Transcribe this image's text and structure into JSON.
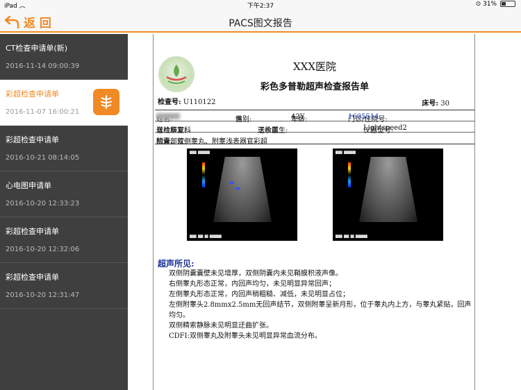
{
  "status_bar": {
    "device": "iPad",
    "time": "下午2:37",
    "battery": "31%",
    "battery_level": 0.31
  },
  "nav": {
    "back_label": "返 回",
    "title": "PACS图文报告"
  },
  "sidebar": {
    "items": [
      {
        "title": "CT检查申请单(新)",
        "date": "2016-11-14 09:00:39"
      },
      {
        "title": "彩超检查申请单",
        "date": "2016-11-07 16:00:21",
        "active": true
      },
      {
        "title": "彩超检查申请单",
        "date": "2016-10-21 08:14:05"
      },
      {
        "title": "心电图申请单",
        "date": "2016-10-20 12:33:23"
      },
      {
        "title": "彩超检查申请单",
        "date": "2016-10-20 12:32:06"
      },
      {
        "title": "彩超检查申请单",
        "date": "2016-10-20 12:31:47"
      }
    ]
  },
  "report": {
    "hospital": "XXX医院",
    "title": "彩色多普勒超声检查报告单",
    "exam_no_label": "检查号:",
    "exam_no": "U110122",
    "bed_label": "床号:",
    "bed_no": "30",
    "name_label": "姓名:",
    "gender_label": "性别:",
    "gender": "男",
    "age_label": "年龄:",
    "age": "42Y",
    "inpatient_label": "门诊/住院号:",
    "inpatient_no": "1605514",
    "dept_label": "送检科室:",
    "dept": "脊柱康复科",
    "doctor_label": "送检医生:",
    "doctor": "王永霞",
    "device_label": "仪器型号:",
    "device": "Lightspeed2",
    "site_label": "检查部位:",
    "site": "阴囊、双侧睾丸、附睾浅表器官彩超",
    "findings_title": "超声所见:",
    "findings": [
      "双侧阴囊囊壁未见增厚，双侧阴囊内未见鞘膜积液声像。",
      "右侧睾丸形态正常，内回声均匀，未见明显异常回声；",
      "左侧睾丸形态正常，内回声稍粗糙、减低，未见明显占位；",
      "左侧附睾头2.8mmx2.5mm无回声结节，双侧附睾呈新月形，位于睾丸内上方，与睾丸紧贴，回声均匀。",
      "双侧精索静脉未见明显迂曲扩张。",
      "CDFI:双侧睾丸及附睾头未见明显异常血流分布。"
    ]
  }
}
